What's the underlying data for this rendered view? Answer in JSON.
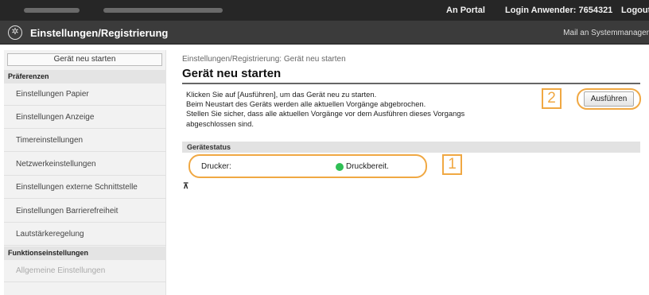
{
  "topbar": {
    "portal_link": "An Portal",
    "login_text": "Login Anwender: 7654321",
    "logout_text": "Logout"
  },
  "header": {
    "logo_icon": "settings-gear-icon",
    "title": "Einstellungen/Registrierung",
    "mail_link": "Mail an Systemmanager"
  },
  "sidebar": {
    "top_item": "Gerät neu starten",
    "section_preferences": "Präferenzen",
    "items": [
      "Einstellungen Papier",
      "Einstellungen Anzeige",
      "Timereinstellungen",
      "Netzwerkeinstellungen",
      "Einstellungen externe Schnittstelle",
      "Einstellungen Barrierefreiheit",
      "Lautstärkeregelung"
    ],
    "section_function": "Funktionseinstellungen",
    "faded_item": "Allgemeine Einstellungen"
  },
  "main": {
    "breadcrumb": "Einstellungen/Registrierung: Gerät neu starten",
    "title": "Gerät neu starten",
    "description_lines": [
      "Klicken Sie auf [Ausführen], um das Gerät neu zu starten.",
      "Beim Neustart des Geräts werden alle aktuellen Vorgänge abgebrochen.",
      "Stellen Sie sicher, dass alle aktuellen Vorgänge vor dem Ausführen dieses Vorgangs",
      "abgeschlossen sind."
    ],
    "execute_button": "Ausführen",
    "status_section": "Gerätestatus",
    "status_label": "Drucker:",
    "status_value": "Druckbereit.",
    "status_color": "#2fbf55",
    "top_link_icon": "back-to-top-icon",
    "top_link_glyph": "⊼"
  },
  "callouts": {
    "one": "1",
    "two": "2",
    "accent": "#f0a843"
  }
}
